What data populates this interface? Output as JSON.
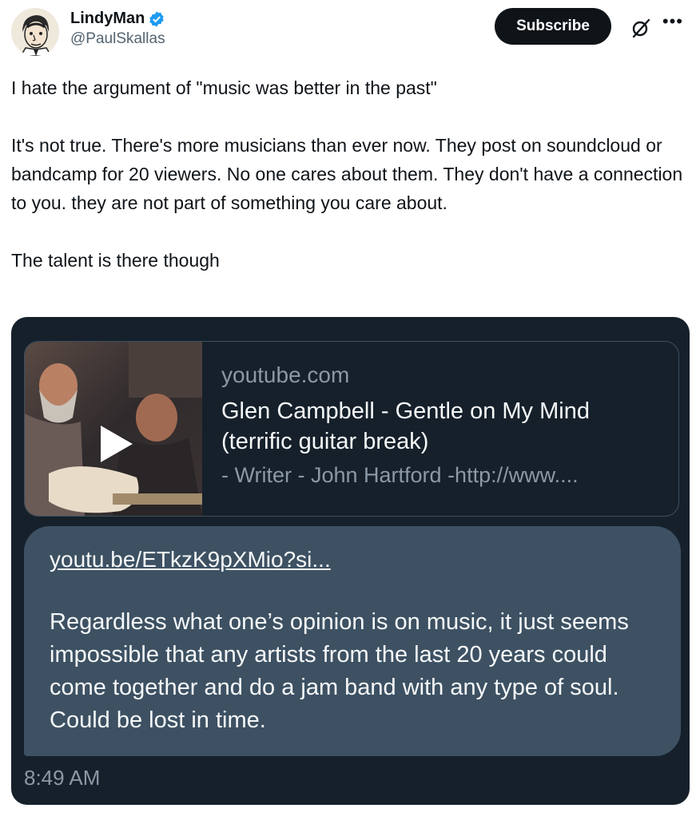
{
  "author": {
    "display_name": "LindyMan",
    "handle": "@PaulSkallas",
    "verified": true
  },
  "actions": {
    "subscribe_label": "Subscribe",
    "grok_icon": "grok-slash-icon",
    "more_icon": "more-dots-icon"
  },
  "tweet": {
    "text": "I hate the argument of \"music was better in the past\"\n\nIt's not true. There's more musicians than ever now. They post on soundcloud or bandcamp for 20 viewers. No one cares about them. They don't have a connection to you. they are not part of something you care about.\n\nThe talent is there though"
  },
  "screenshot": {
    "link_card": {
      "domain": "youtube.com",
      "title": "Glen Campbell - Gentle on My Mind (terrific guitar break)",
      "description": "- Writer - John Hartford -http://www....",
      "thumbnail_icon": "play-icon"
    },
    "message": {
      "link": "youtu.be/ETkzK9pXMio?si...",
      "text": "Regardless what one’s opinion is on music, it just seems impossible that any artists from the last 20 years could come together and do a jam band with any type of soul. Could be lost in time.",
      "time": "8:49 AM"
    }
  },
  "colors": {
    "brand_blue": "#1d9bf0",
    "dark_bg": "#15202b",
    "bubble_bg": "#3d5163"
  }
}
